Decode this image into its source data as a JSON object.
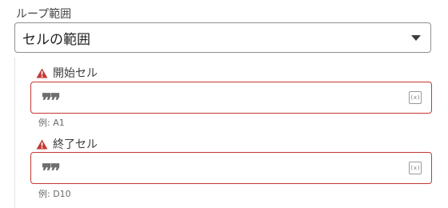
{
  "loop": {
    "label": "ループ範囲",
    "selected": "セルの範囲"
  },
  "fields": [
    {
      "label": "開始セル",
      "example": "例: A1"
    },
    {
      "label": "終了セル",
      "example": "例: D10"
    }
  ],
  "icons": {
    "warning": "warning-icon",
    "quote": "quote-icon",
    "formula": "formula-icon",
    "dropdown": "chevron-down-icon",
    "quote_glyph": "❞❞",
    "formula_glyph": "(x)"
  },
  "colors": {
    "error": "#c23934",
    "border": "#8f8f8f"
  }
}
